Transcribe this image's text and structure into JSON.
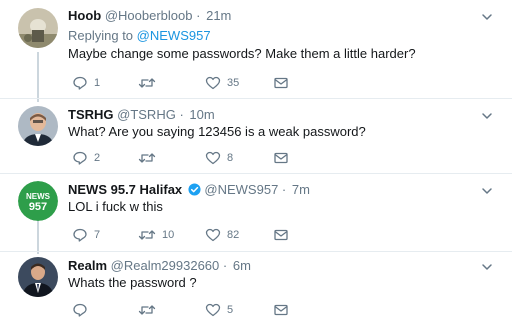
{
  "tweets": [
    {
      "name": "Hoob",
      "handle": "@Hooberbloob",
      "dot": "·",
      "time": "21m",
      "replying_prefix": "Replying to",
      "replying_mention": "@NEWS957",
      "text": "Maybe change some passwords? Make them a little harder?",
      "replies": "1",
      "retweets": "",
      "likes": "35"
    },
    {
      "name": "TSRHG",
      "handle": "@TSRHG",
      "dot": "·",
      "time": "10m",
      "text": "What? Are you saying 123456 is a weak password?",
      "replies": "2",
      "retweets": "",
      "likes": "8"
    },
    {
      "name": "NEWS 95.7 Halifax",
      "handle": "@NEWS957",
      "dot": "·",
      "time": "7m",
      "text": "LOL i fuck w this",
      "replies": "7",
      "retweets": "10",
      "likes": "82",
      "avatar_text_top": "NEWS",
      "avatar_text_bottom": "957"
    },
    {
      "name": "Realm",
      "handle": "@Realm29932660",
      "dot": "·",
      "time": "6m",
      "text": "Whats the password ?",
      "replies": "",
      "retweets": "",
      "likes": "5"
    }
  ],
  "colors": {
    "muted": "#657786",
    "link": "#1b95e0",
    "verified": "#1da1f2",
    "news_green": "#2e9e4a",
    "thread_line": "#ccd6dd"
  },
  "icons": [
    "reply-icon",
    "retweet-icon",
    "like-icon",
    "message-icon",
    "chevron-down-icon",
    "verified-badge-icon"
  ]
}
